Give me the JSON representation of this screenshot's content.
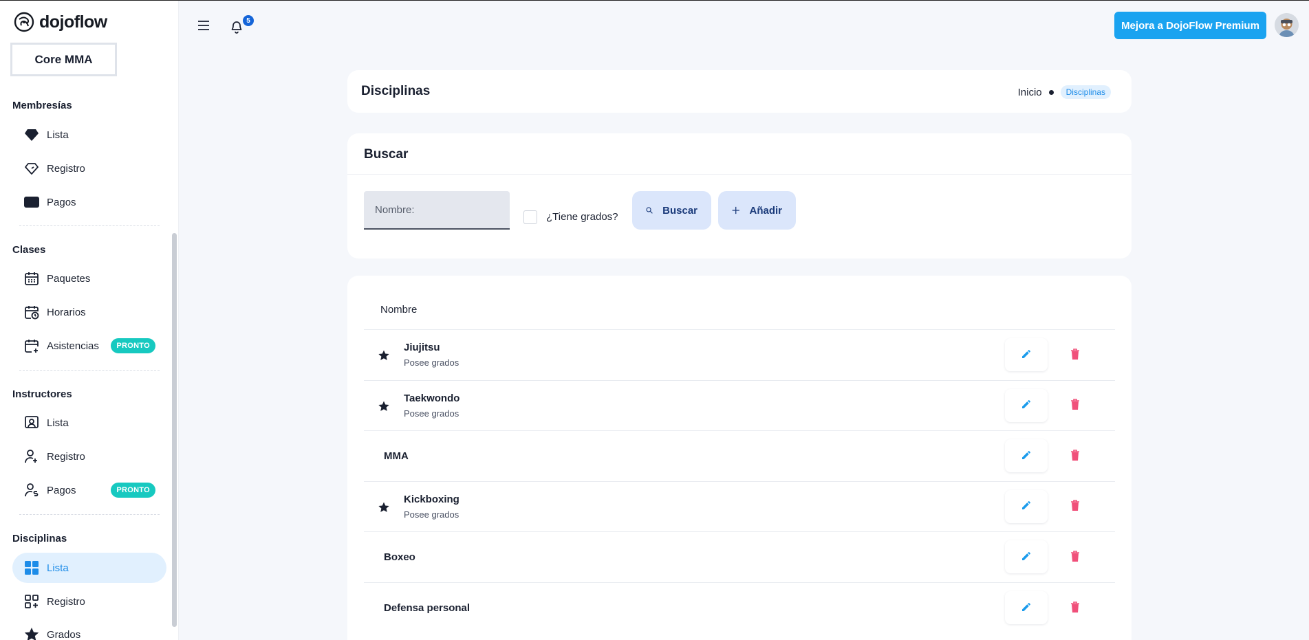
{
  "brand": {
    "name": "dojoflow"
  },
  "org": {
    "name": "Core MMA"
  },
  "sidebar": {
    "sections": [
      {
        "title": "Membresías",
        "items": [
          {
            "label": "Lista",
            "icon": "diamond-icon"
          },
          {
            "label": "Registro",
            "icon": "diamond-outline-icon"
          },
          {
            "label": "Pagos",
            "icon": "card-icon"
          }
        ]
      },
      {
        "title": "Clases",
        "items": [
          {
            "label": "Paquetes",
            "icon": "calendar-icon"
          },
          {
            "label": "Horarios",
            "icon": "calendar-clock-icon"
          },
          {
            "label": "Asistencias",
            "icon": "calendar-plus-icon",
            "badge": "PRONTO"
          }
        ]
      },
      {
        "title": "Instructores",
        "items": [
          {
            "label": "Lista",
            "icon": "user-board-icon"
          },
          {
            "label": "Registro",
            "icon": "user-plus-icon"
          },
          {
            "label": "Pagos",
            "icon": "user-dollar-icon",
            "badge": "PRONTO"
          }
        ]
      },
      {
        "title": "Disciplinas",
        "items": [
          {
            "label": "Lista",
            "icon": "grid-icon",
            "active": true
          },
          {
            "label": "Registro",
            "icon": "grid-plus-icon"
          },
          {
            "label": "Grados",
            "icon": "star-icon"
          }
        ]
      }
    ]
  },
  "topbar": {
    "notifications_count": "5",
    "premium_label": "Mejora a DojoFlow Premium"
  },
  "header": {
    "title": "Disciplinas",
    "breadcrumb": [
      "Inicio",
      "Disciplinas"
    ]
  },
  "search": {
    "title": "Buscar",
    "name_placeholder": "Nombre:",
    "has_grades_label": "¿Tiene grados?",
    "search_label": "Buscar",
    "add_label": "Añadir"
  },
  "table": {
    "header": "Nombre",
    "rows": [
      {
        "name": "Jiujitsu",
        "sub": "Posee grados",
        "has_grades": true
      },
      {
        "name": "Taekwondo",
        "sub": "Posee grados",
        "has_grades": true
      },
      {
        "name": "MMA",
        "sub": "",
        "has_grades": false
      },
      {
        "name": "Kickboxing",
        "sub": "Posee grados",
        "has_grades": true
      },
      {
        "name": "Boxeo",
        "sub": "",
        "has_grades": false
      },
      {
        "name": "Defensa personal",
        "sub": "",
        "has_grades": false
      }
    ]
  },
  "colors": {
    "accent": "#1aa3f0",
    "active_bg": "#e1f0fe",
    "badge": "#17c9c0",
    "danger": "#f0507a"
  }
}
